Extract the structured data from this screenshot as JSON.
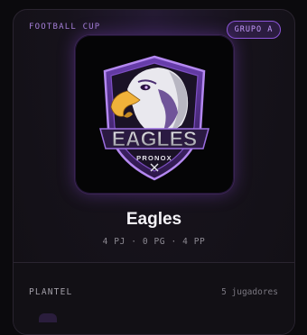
{
  "card": {
    "league": "FOOTBALL CUP",
    "group_badge": "GRUPO A"
  },
  "team": {
    "logo_text": "EAGLES",
    "logo_subtext": "PRONOX",
    "name": "Eagles",
    "stats": "4 PJ · 0 PG · 4 PP"
  },
  "roster": {
    "title": "PLANTEL",
    "count": "5 jugadores"
  },
  "colors": {
    "accent": "#a57fd8",
    "badge_border": "#8c55d8",
    "background": "#0b0a0d"
  }
}
